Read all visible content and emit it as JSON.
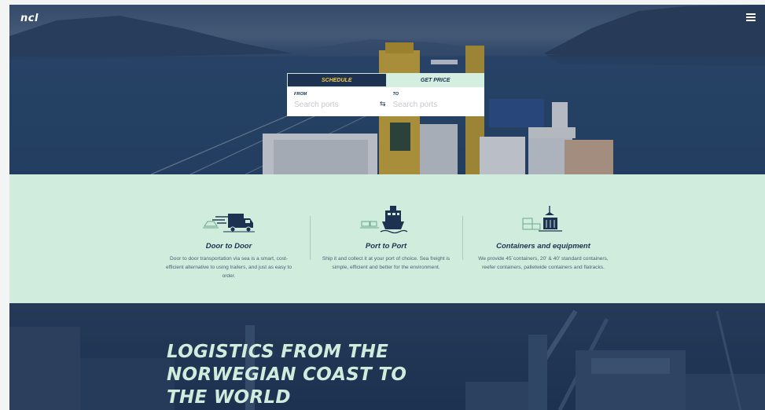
{
  "header": {
    "logo": "ncl",
    "menu_icon": "hamburger-icon"
  },
  "search": {
    "tabs": [
      {
        "label": "SCHEDULE",
        "active": true
      },
      {
        "label": "GET PRICE",
        "active": false
      }
    ],
    "from": {
      "label": "FROM",
      "placeholder": "Search ports",
      "value": ""
    },
    "to": {
      "label": "TO",
      "placeholder": "Search ports",
      "value": ""
    },
    "swap_icon": "swap-arrows-icon"
  },
  "services": [
    {
      "icon": "truck-icon",
      "title": "Door to Door",
      "description": "Door to door transportation via sea is a smart, cost-efficient alternative to using trailers, and just as easy to order."
    },
    {
      "icon": "ship-icon",
      "title": "Port to Port",
      "description": "Ship it and collect it at your port of choice. Sea freight is simple, efficient and better for the environment."
    },
    {
      "icon": "container-crane-icon",
      "title": "Containers and equipment",
      "description": "We provide 45´containers, 20' & 40' standard containers, reefer containers, palletwide containers and flatracks."
    }
  ],
  "headline": {
    "line1": "LOGISTICS FROM THE",
    "line2": "NORWEGIAN COAST TO",
    "line3": "THE WORLD"
  },
  "colors": {
    "navy": "#1d3150",
    "mint": "#d0ecdd",
    "accent_yellow": "#f4c94a"
  }
}
